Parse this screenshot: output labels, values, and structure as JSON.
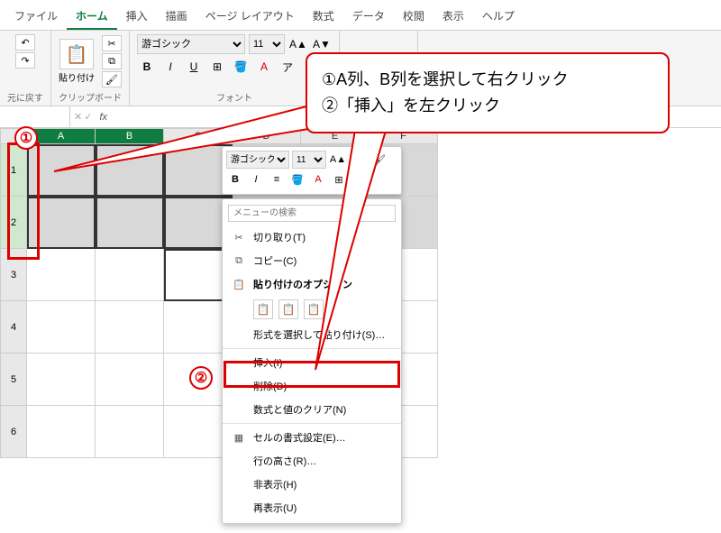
{
  "menu": {
    "file": "ファイル",
    "home": "ホーム",
    "insert": "挿入",
    "draw": "描画",
    "pagelayout": "ページ レイアウト",
    "formulas": "数式",
    "data": "データ",
    "review": "校閲",
    "view": "表示",
    "help": "ヘルプ"
  },
  "ribbon": {
    "undo_label": "元に戻す",
    "clipboard_label": "クリップボード",
    "paste_label": "貼り付け",
    "font_label": "フォント",
    "font_name": "游ゴシック",
    "font_size": "11",
    "bold": "B",
    "italic": "I",
    "underline": "U"
  },
  "namebox": {
    "value": ""
  },
  "columns": [
    "A",
    "B",
    "C",
    "D",
    "E",
    "F"
  ],
  "rows": [
    "1",
    "2",
    "3",
    "4",
    "5",
    "6"
  ],
  "mini": {
    "font_name": "游ゴシック",
    "font_size": "11"
  },
  "context": {
    "search_placeholder": "メニューの検索",
    "cut": "切り取り(T)",
    "copy": "コピー(C)",
    "paste_options": "貼り付けのオプション",
    "paste_special": "形式を選択して貼り付け(S)…",
    "insert": "挿入(I)",
    "delete": "削除(D)",
    "clear": "数式と値のクリア(N)",
    "format_cells": "セルの書式設定(E)…",
    "row_height": "行の高さ(R)…",
    "hide": "非表示(H)",
    "unhide": "再表示(U)"
  },
  "callout": {
    "line1": "①A列、B列を選択して右クリック",
    "line2": "②「挿入」を左クリック"
  },
  "anno": {
    "one": "①",
    "two": "②"
  }
}
